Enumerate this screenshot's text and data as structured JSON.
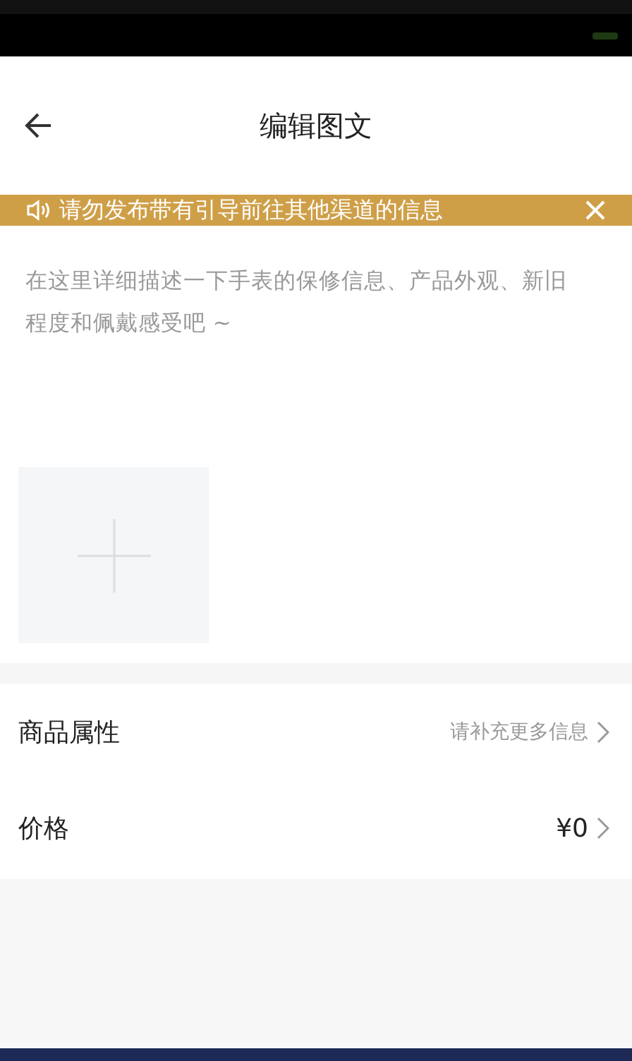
{
  "header": {
    "title": "编辑图文"
  },
  "notice": {
    "text": "请勿发布带有引导前往其他渠道的信息"
  },
  "description": {
    "placeholder": "在这里详细描述一下手表的保修信息、产品外观、新旧程度和佩戴感受吧 ~"
  },
  "rows": [
    {
      "label": "商品属性",
      "value": "请补充更多信息",
      "kind": "hint"
    },
    {
      "label": "价格",
      "value": "¥0",
      "kind": "value"
    }
  ]
}
